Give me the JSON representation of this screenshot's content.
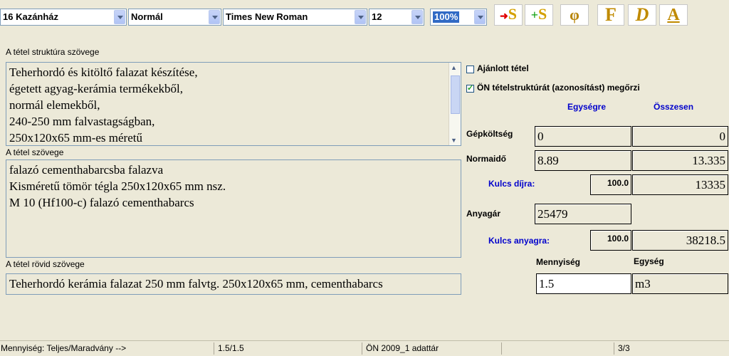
{
  "toolbar": {
    "location_select": "16 Kazánház",
    "style_select": "Normál",
    "font_select": "Times New Roman",
    "size_select": "12",
    "zoom_select": "100%",
    "buttons": {
      "move_s": "S",
      "add_s": "S",
      "phi": "φ",
      "bold_f": "F",
      "italic_d": "D",
      "underline_a": "A"
    }
  },
  "left": {
    "structure_label": "A tétel struktúra szövege",
    "structure_lines": [
      "Teherhordó és kitöltő falazat készítése,",
      "égetett agyag-kerámia termékekből,",
      "normál elemekből,",
      "240-250 mm falvastagságban,",
      "250x120x65 mm-es méretű"
    ],
    "item_label": "A tétel szövege",
    "item_lines": [
      "falazó cementhabarcsba falazva",
      "Kisméretű tömör tégla 250x120x65 mm nsz.",
      "M 10 (Hf100-c) falazó cementhabarcs"
    ],
    "short_label": "A tétel rövid szövege",
    "short_text": "Teherhordó kerámia falazat 250 mm falvtg. 250x120x65 mm, cementhabarcs"
  },
  "right": {
    "recommended_label": "Ajánlott tétel",
    "recommended_checked": false,
    "preserve_label": "ÖN tételstruktúrát (azonosítást) megőrzi",
    "preserve_checked": true,
    "col_unit": "Egységre",
    "col_total": "Összesen",
    "machine_cost_label": "Gépköltség",
    "machine_cost_unit": "0",
    "machine_cost_total": "0",
    "norm_time_label": "Normaidő",
    "norm_time_unit": "8.89",
    "norm_time_total": "13.335",
    "key_fee_label": "Kulcs díjra:",
    "key_fee_value": "100.0",
    "key_fee_total": "13335",
    "material_price_label": "Anyagár",
    "material_price_unit": "25479",
    "key_material_label": "Kulcs anyagra:",
    "key_material_value": "100.0",
    "key_material_total": "38218.5",
    "quantity_label": "Mennyiség",
    "unit_label": "Egység",
    "quantity_value": "1.5",
    "unit_value": "m3"
  },
  "statusbar": {
    "quantity_text": "Mennyiség:  Teljes/Maradvány -->",
    "quantity_ratio": "1.5/1.5",
    "dataset": "ÖN 2009_1 adattár",
    "page": "3/3"
  },
  "colors": {
    "background": "#ece9d8",
    "accent_blue": "#0000cc",
    "selection": "#316ac5"
  }
}
